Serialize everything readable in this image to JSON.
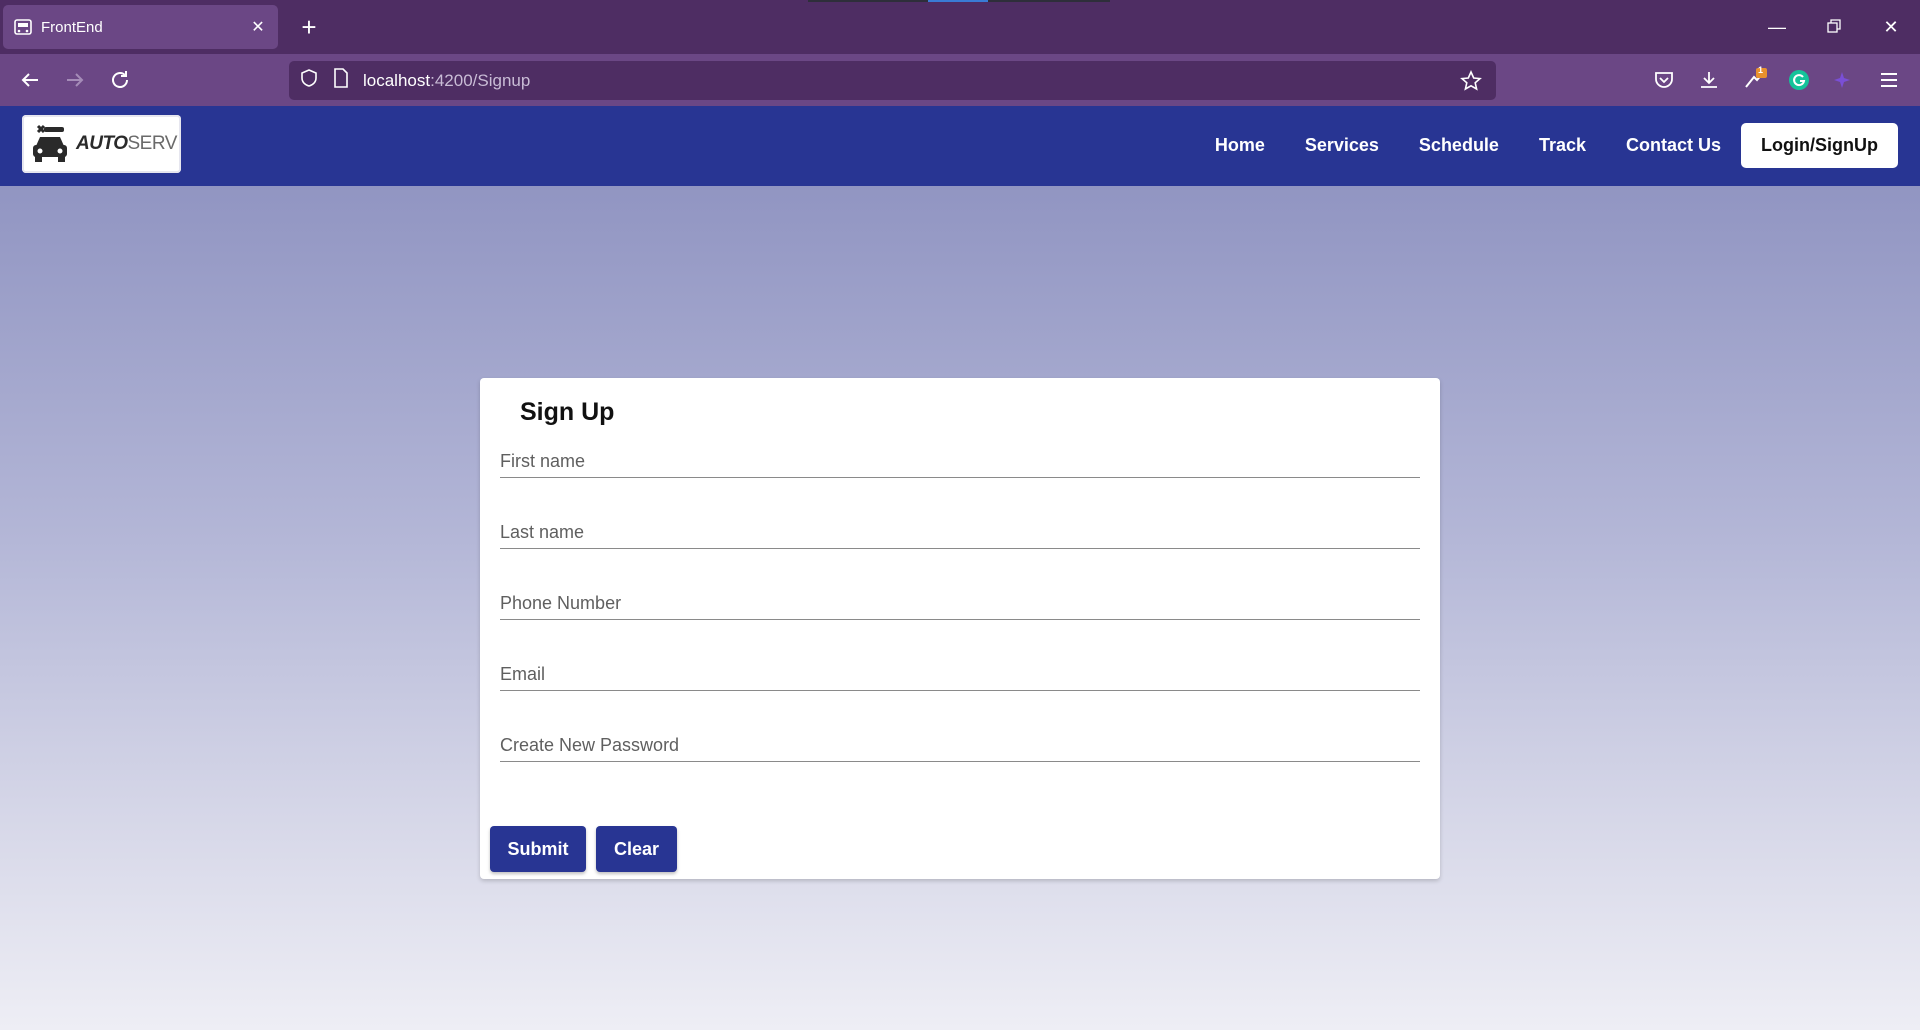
{
  "browser": {
    "tab_title": "FrontEnd",
    "url_host": "localhost",
    "url_rest": ":4200/Signup",
    "extension_badge": "1"
  },
  "site": {
    "logo_bold": "AUTO",
    "logo_light": "SERV",
    "nav": {
      "home": "Home",
      "services": "Services",
      "schedule": "Schedule",
      "track": "Track",
      "contact": "Contact Us",
      "login": "Login/SignUp"
    },
    "colors": {
      "primary": "#283593",
      "browser_bg": "#4e2d63",
      "toolbar_bg": "#6b4785"
    }
  },
  "form": {
    "title": "Sign Up",
    "fields": {
      "first_name": "First name",
      "last_name": "Last name",
      "phone": "Phone Number",
      "email": "Email",
      "password": "Create New Password"
    },
    "submit_label": "Submit",
    "clear_label": "Clear"
  }
}
